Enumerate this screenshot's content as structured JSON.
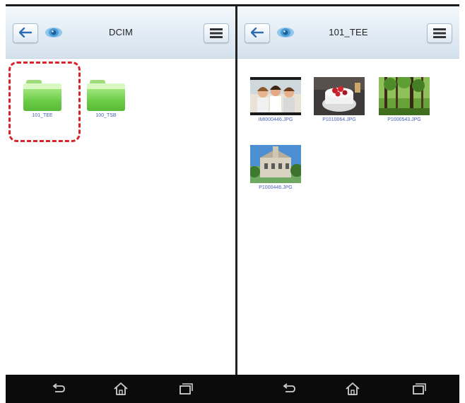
{
  "left_panel": {
    "title": "DCIM",
    "folders": [
      {
        "name": "101_TEE",
        "highlighted": true
      },
      {
        "name": "100_TSB",
        "highlighted": false
      }
    ]
  },
  "right_panel": {
    "title": "101_TEE",
    "files": [
      {
        "name": "IMI000446.JPG"
      },
      {
        "name": "P1010064.JPG"
      },
      {
        "name": "P1000543.JPG"
      },
      {
        "name": "P1000446.JPG"
      }
    ]
  },
  "icons": {
    "back": "back-arrow-icon",
    "view": "eye-icon",
    "menu": "menu-icon",
    "folder": "folder-icon",
    "nav_back": "nav-back-icon",
    "nav_home": "nav-home-icon",
    "nav_recents": "nav-recents-icon"
  },
  "colors": {
    "folder_green": "#6fcf4a",
    "label_blue": "#4a63b8",
    "highlight_red": "#d9232c",
    "nav_bar": "#0b0b0b"
  }
}
